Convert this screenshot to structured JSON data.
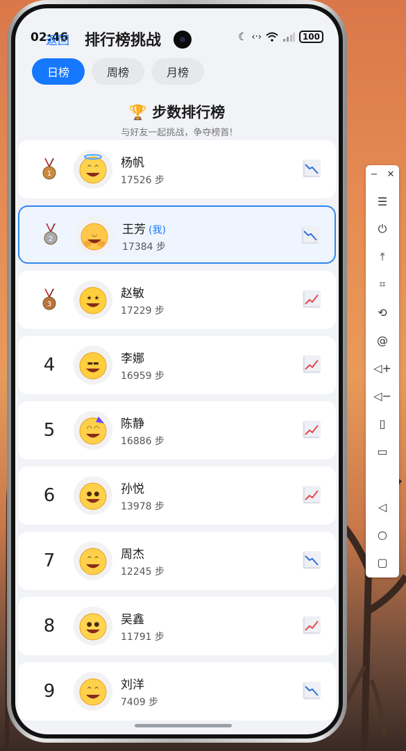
{
  "status_bar": {
    "time": "02:46",
    "battery": "100"
  },
  "header": {
    "back_label": "返回",
    "title": "排行榜挑战"
  },
  "tabs": [
    {
      "label": "日榜",
      "active": true
    },
    {
      "label": "周榜",
      "active": false
    },
    {
      "label": "月榜",
      "active": false
    }
  ],
  "leaderboard": {
    "title": "🏆 步数排行榜",
    "subtitle": "与好友一起挑战，争夺榜首!",
    "me_tag": "(我)",
    "rows": [
      {
        "rank": "1",
        "medal": "bronze-medal-1",
        "avatar": "smiling-face-with-halo",
        "name": "杨帆",
        "steps": "17526 步",
        "trend": "down",
        "is_me": false
      },
      {
        "rank": "2",
        "medal": "silver-medal-2",
        "avatar": "hugging-face",
        "name": "王芳",
        "steps": "17384 步",
        "trend": "down",
        "is_me": true
      },
      {
        "rank": "3",
        "medal": "bronze-medal-3",
        "avatar": "star-struck",
        "name": "赵敏",
        "steps": "17229 步",
        "trend": "up",
        "is_me": false
      },
      {
        "rank": "4",
        "avatar": "sunglasses-face",
        "name": "李娜",
        "steps": "16959 步",
        "trend": "up",
        "is_me": false
      },
      {
        "rank": "5",
        "avatar": "partying-face",
        "name": "陈静",
        "steps": "16886 步",
        "trend": "up",
        "is_me": false
      },
      {
        "rank": "6",
        "avatar": "grinning-face",
        "name": "孙悦",
        "steps": "13978 步",
        "trend": "up",
        "is_me": false
      },
      {
        "rank": "7",
        "avatar": "grinning-squinting-face",
        "name": "周杰",
        "steps": "12245 步",
        "trend": "down",
        "is_me": false
      },
      {
        "rank": "8",
        "avatar": "slightly-smiling-face",
        "name": "吴鑫",
        "steps": "11791 步",
        "trend": "up",
        "is_me": false
      },
      {
        "rank": "9",
        "avatar": "grinning-squinting-face",
        "name": "刘洋",
        "steps": "7409 步",
        "trend": "down",
        "is_me": false
      }
    ]
  },
  "colors": {
    "accent": "#1677ff",
    "trend_up": "#e5484d",
    "trend_down": "#2f6fe0"
  },
  "side_toolbar": {
    "buttons": [
      "menu-icon",
      "power-icon",
      "pin-top-icon",
      "crop-icon",
      "rotate-icon",
      "at-icon",
      "volume-up-icon",
      "volume-down-icon",
      "screen-rotate-icon",
      "screenshot-icon",
      "back-triangle-icon",
      "home-circle-icon",
      "recents-square-icon"
    ]
  }
}
